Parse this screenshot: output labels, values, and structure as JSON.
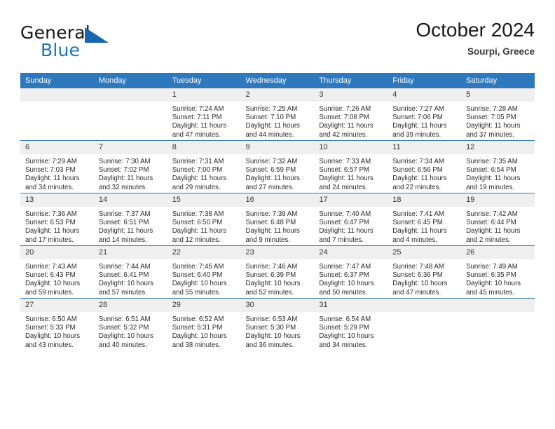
{
  "brand": {
    "line1": "General",
    "line2": "Blue",
    "triangle_icon": "triangle-icon",
    "accent_color": "#1c75bc"
  },
  "header": {
    "title": "October 2024",
    "subtitle": "Sourpi, Greece"
  },
  "theme": {
    "header_bg": "#2e78bd",
    "daynum_bg": "#efefef",
    "text": "#2b2b2b"
  },
  "weekdays": [
    "Sunday",
    "Monday",
    "Tuesday",
    "Wednesday",
    "Thursday",
    "Friday",
    "Saturday"
  ],
  "labels": {
    "sunrise": "Sunrise:",
    "sunset": "Sunset:",
    "daylight": "Daylight:"
  },
  "weeks": [
    [
      {
        "day": "",
        "sunrise": "",
        "sunset": "",
        "daylight": ""
      },
      {
        "day": "",
        "sunrise": "",
        "sunset": "",
        "daylight": ""
      },
      {
        "day": "1",
        "sunrise": "Sunrise: 7:24 AM",
        "sunset": "Sunset: 7:11 PM",
        "daylight": "Daylight: 11 hours and 47 minutes."
      },
      {
        "day": "2",
        "sunrise": "Sunrise: 7:25 AM",
        "sunset": "Sunset: 7:10 PM",
        "daylight": "Daylight: 11 hours and 44 minutes."
      },
      {
        "day": "3",
        "sunrise": "Sunrise: 7:26 AM",
        "sunset": "Sunset: 7:08 PM",
        "daylight": "Daylight: 11 hours and 42 minutes."
      },
      {
        "day": "4",
        "sunrise": "Sunrise: 7:27 AM",
        "sunset": "Sunset: 7:06 PM",
        "daylight": "Daylight: 11 hours and 39 minutes."
      },
      {
        "day": "5",
        "sunrise": "Sunrise: 7:28 AM",
        "sunset": "Sunset: 7:05 PM",
        "daylight": "Daylight: 11 hours and 37 minutes."
      }
    ],
    [
      {
        "day": "6",
        "sunrise": "Sunrise: 7:29 AM",
        "sunset": "Sunset: 7:03 PM",
        "daylight": "Daylight: 11 hours and 34 minutes."
      },
      {
        "day": "7",
        "sunrise": "Sunrise: 7:30 AM",
        "sunset": "Sunset: 7:02 PM",
        "daylight": "Daylight: 11 hours and 32 minutes."
      },
      {
        "day": "8",
        "sunrise": "Sunrise: 7:31 AM",
        "sunset": "Sunset: 7:00 PM",
        "daylight": "Daylight: 11 hours and 29 minutes."
      },
      {
        "day": "9",
        "sunrise": "Sunrise: 7:32 AM",
        "sunset": "Sunset: 6:59 PM",
        "daylight": "Daylight: 11 hours and 27 minutes."
      },
      {
        "day": "10",
        "sunrise": "Sunrise: 7:33 AM",
        "sunset": "Sunset: 6:57 PM",
        "daylight": "Daylight: 11 hours and 24 minutes."
      },
      {
        "day": "11",
        "sunrise": "Sunrise: 7:34 AM",
        "sunset": "Sunset: 6:56 PM",
        "daylight": "Daylight: 11 hours and 22 minutes."
      },
      {
        "day": "12",
        "sunrise": "Sunrise: 7:35 AM",
        "sunset": "Sunset: 6:54 PM",
        "daylight": "Daylight: 11 hours and 19 minutes."
      }
    ],
    [
      {
        "day": "13",
        "sunrise": "Sunrise: 7:36 AM",
        "sunset": "Sunset: 6:53 PM",
        "daylight": "Daylight: 11 hours and 17 minutes."
      },
      {
        "day": "14",
        "sunrise": "Sunrise: 7:37 AM",
        "sunset": "Sunset: 6:51 PM",
        "daylight": "Daylight: 11 hours and 14 minutes."
      },
      {
        "day": "15",
        "sunrise": "Sunrise: 7:38 AM",
        "sunset": "Sunset: 6:50 PM",
        "daylight": "Daylight: 11 hours and 12 minutes."
      },
      {
        "day": "16",
        "sunrise": "Sunrise: 7:39 AM",
        "sunset": "Sunset: 6:48 PM",
        "daylight": "Daylight: 11 hours and 9 minutes."
      },
      {
        "day": "17",
        "sunrise": "Sunrise: 7:40 AM",
        "sunset": "Sunset: 6:47 PM",
        "daylight": "Daylight: 11 hours and 7 minutes."
      },
      {
        "day": "18",
        "sunrise": "Sunrise: 7:41 AM",
        "sunset": "Sunset: 6:45 PM",
        "daylight": "Daylight: 11 hours and 4 minutes."
      },
      {
        "day": "19",
        "sunrise": "Sunrise: 7:42 AM",
        "sunset": "Sunset: 6:44 PM",
        "daylight": "Daylight: 11 hours and 2 minutes."
      }
    ],
    [
      {
        "day": "20",
        "sunrise": "Sunrise: 7:43 AM",
        "sunset": "Sunset: 6:43 PM",
        "daylight": "Daylight: 10 hours and 59 minutes."
      },
      {
        "day": "21",
        "sunrise": "Sunrise: 7:44 AM",
        "sunset": "Sunset: 6:41 PM",
        "daylight": "Daylight: 10 hours and 57 minutes."
      },
      {
        "day": "22",
        "sunrise": "Sunrise: 7:45 AM",
        "sunset": "Sunset: 6:40 PM",
        "daylight": "Daylight: 10 hours and 55 minutes."
      },
      {
        "day": "23",
        "sunrise": "Sunrise: 7:46 AM",
        "sunset": "Sunset: 6:39 PM",
        "daylight": "Daylight: 10 hours and 52 minutes."
      },
      {
        "day": "24",
        "sunrise": "Sunrise: 7:47 AM",
        "sunset": "Sunset: 6:37 PM",
        "daylight": "Daylight: 10 hours and 50 minutes."
      },
      {
        "day": "25",
        "sunrise": "Sunrise: 7:48 AM",
        "sunset": "Sunset: 6:36 PM",
        "daylight": "Daylight: 10 hours and 47 minutes."
      },
      {
        "day": "26",
        "sunrise": "Sunrise: 7:49 AM",
        "sunset": "Sunset: 6:35 PM",
        "daylight": "Daylight: 10 hours and 45 minutes."
      }
    ],
    [
      {
        "day": "27",
        "sunrise": "Sunrise: 6:50 AM",
        "sunset": "Sunset: 5:33 PM",
        "daylight": "Daylight: 10 hours and 43 minutes."
      },
      {
        "day": "28",
        "sunrise": "Sunrise: 6:51 AM",
        "sunset": "Sunset: 5:32 PM",
        "daylight": "Daylight: 10 hours and 40 minutes."
      },
      {
        "day": "29",
        "sunrise": "Sunrise: 6:52 AM",
        "sunset": "Sunset: 5:31 PM",
        "daylight": "Daylight: 10 hours and 38 minutes."
      },
      {
        "day": "30",
        "sunrise": "Sunrise: 6:53 AM",
        "sunset": "Sunset: 5:30 PM",
        "daylight": "Daylight: 10 hours and 36 minutes."
      },
      {
        "day": "31",
        "sunrise": "Sunrise: 6:54 AM",
        "sunset": "Sunset: 5:29 PM",
        "daylight": "Daylight: 10 hours and 34 minutes."
      },
      {
        "day": "",
        "sunrise": "",
        "sunset": "",
        "daylight": ""
      },
      {
        "day": "",
        "sunrise": "",
        "sunset": "",
        "daylight": ""
      }
    ]
  ]
}
